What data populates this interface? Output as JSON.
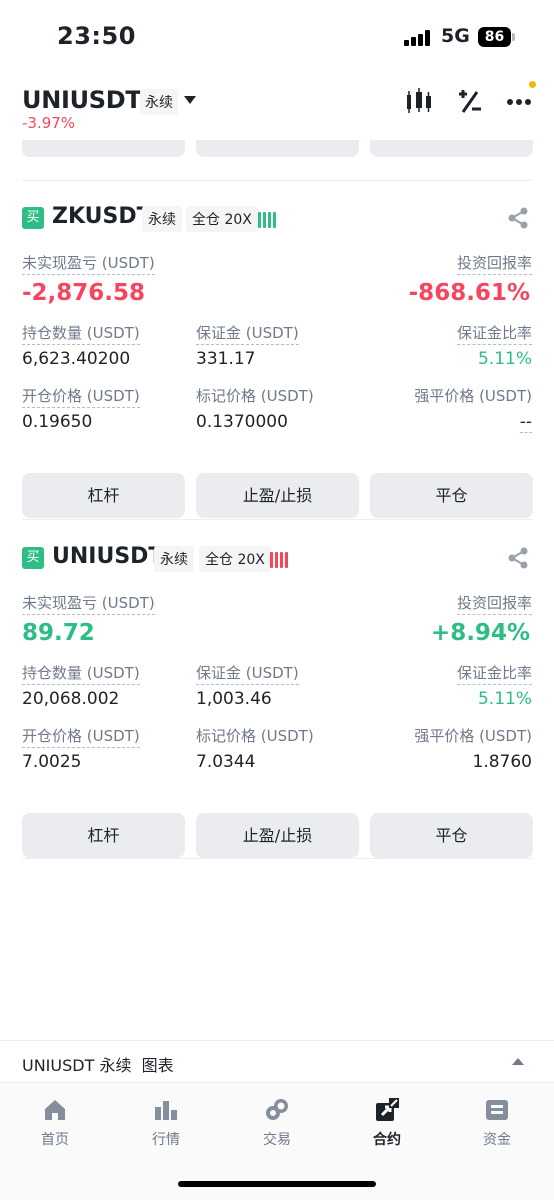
{
  "status": {
    "time": "23:50",
    "network": "5G",
    "battery": "86"
  },
  "header": {
    "symbol": "UNIUSDT",
    "perp_label": "永续",
    "change": "-3.97%",
    "icons": [
      "candlestick-icon",
      "percent-icon",
      "more-icon"
    ],
    "notification_color": "#f0b90b"
  },
  "positions": [
    {
      "side": "买",
      "symbol": "ZKUSDT",
      "perp_label": "永续",
      "margin_mode": "全仓 20X",
      "risk_color": "#2ebd85",
      "pnl_label": "未实现盈亏 (USDT)",
      "pnl": "-2,876.58",
      "roi_label": "投资回报率",
      "roi": "-868.61%",
      "size_label": "持仓数量 (USDT)",
      "size": "6,623.40200",
      "margin_label": "保证金 (USDT)",
      "margin": "331.17",
      "margin_ratio_label": "保证金比率",
      "margin_ratio": "5.11%",
      "entry_label": "开仓价格 (USDT)",
      "entry": "0.19650",
      "mark_label": "标记价格 (USDT)",
      "mark": "0.1370000",
      "liq_label": "强平价格 (USDT)",
      "liq": "--",
      "btn_leverage": "杠杆",
      "btn_tpsl": "止盈/止损",
      "btn_close": "平仓"
    },
    {
      "side": "买",
      "symbol": "UNIUSDT",
      "perp_label": "永续",
      "margin_mode": "全仓 20X",
      "risk_color": "#f6465d",
      "pnl_label": "未实现盈亏 (USDT)",
      "pnl": "89.72",
      "roi_label": "投资回报率",
      "roi": "+8.94%",
      "size_label": "持仓数量 (USDT)",
      "size": "20,068.002",
      "margin_label": "保证金 (USDT)",
      "margin": "1,003.46",
      "margin_ratio_label": "保证金比率",
      "margin_ratio": "5.11%",
      "entry_label": "开仓价格 (USDT)",
      "entry": "7.0025",
      "mark_label": "标记价格 (USDT)",
      "mark": "7.0344",
      "liq_label": "强平价格 (USDT)",
      "liq": "1.8760",
      "btn_leverage": "杠杆",
      "btn_tpsl": "止盈/止损",
      "btn_close": "平仓"
    }
  ],
  "chart_bar": {
    "text": "UNIUSDT 永续  图表"
  },
  "tabs": [
    {
      "label": "首页",
      "icon": "home-icon"
    },
    {
      "label": "行情",
      "icon": "markets-icon"
    },
    {
      "label": "交易",
      "icon": "trade-icon"
    },
    {
      "label": "合约",
      "icon": "futures-icon",
      "active": true
    },
    {
      "label": "资金",
      "icon": "wallet-icon"
    }
  ],
  "colors": {
    "up": "#2ebd85",
    "down": "#f6465d",
    "text": "#1e2329",
    "muted": "#707a8a",
    "button_bg": "#eaecef"
  }
}
